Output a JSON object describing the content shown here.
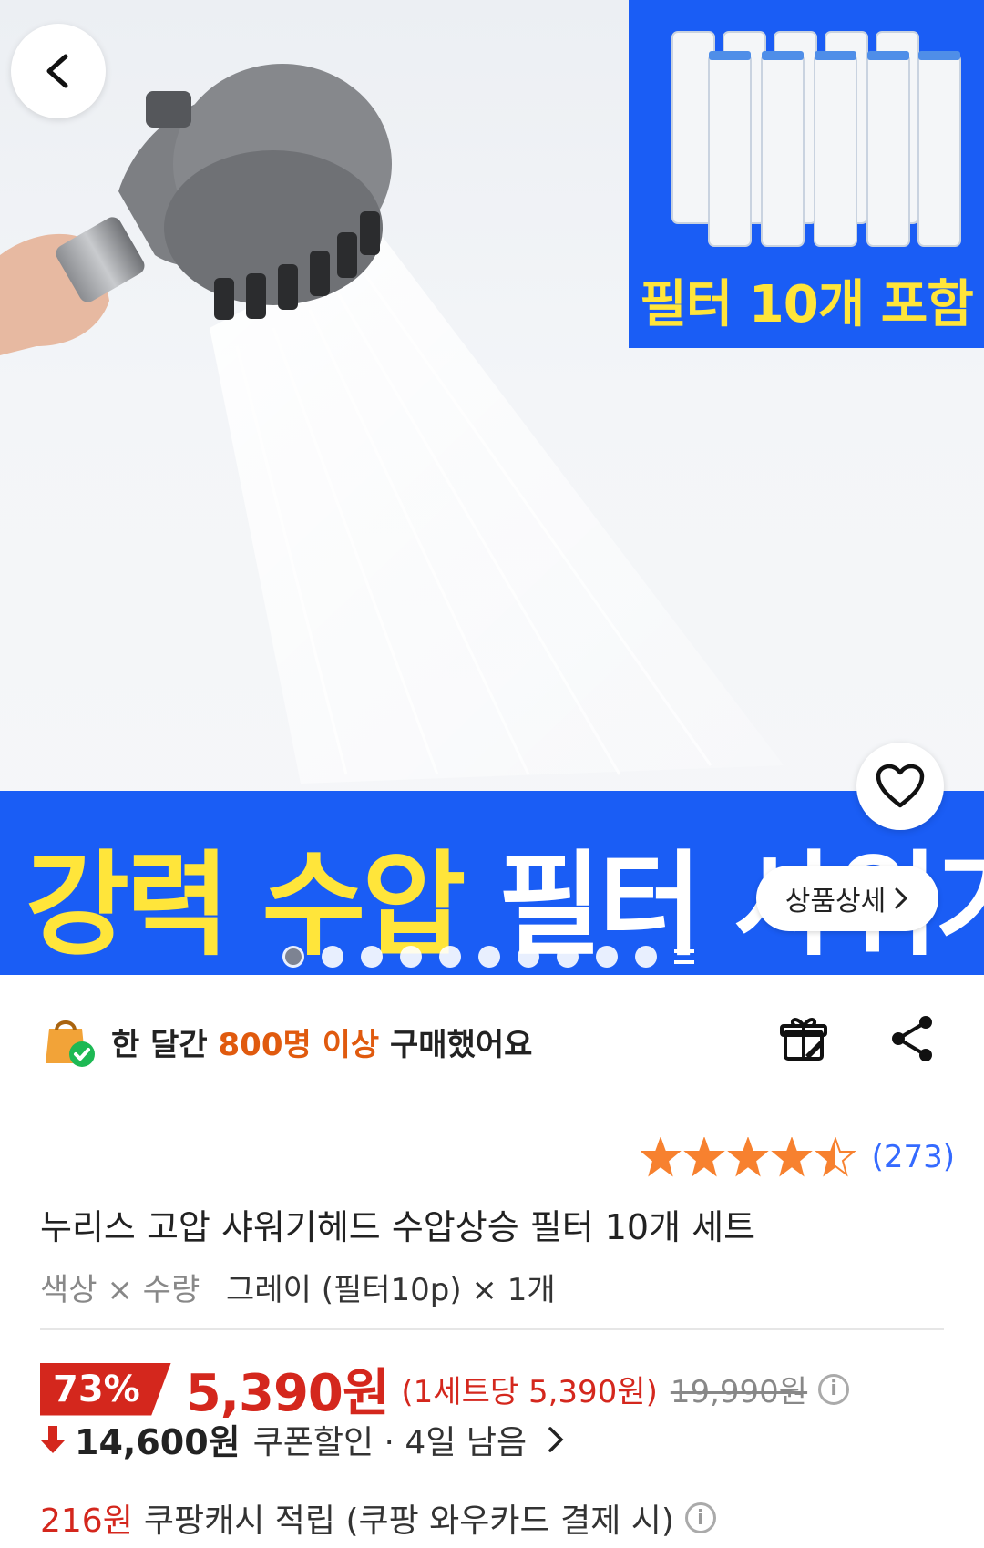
{
  "hero": {
    "filter_caption": "필터 10개 포함",
    "headline_yellow": "강력 수압",
    "headline_white": "필터 샤워기",
    "detail_button": "상품상세",
    "slide_count": 10,
    "active_slide": 1
  },
  "buy_info": {
    "prefix": "한 달간 ",
    "highlight": "800명 이상",
    "suffix": " 구매했어요"
  },
  "rating": {
    "stars": 4.5,
    "review_count": "(273)"
  },
  "product": {
    "title": "누리스 고압 샤워기헤드 수압상승 필터 10개 세트",
    "option_label": "색상 × 수량",
    "option_value": "그레이 (필터10p) × 1개"
  },
  "price": {
    "discount": "73%",
    "sale_price": "5,390원",
    "unit_price": "(1세트당 5,390원)",
    "original_price": "19,990원"
  },
  "coupon": {
    "amount": "14,600원",
    "text": "쿠폰할인 · 4일 남음"
  },
  "cash": {
    "amount": "216원",
    "text": "쿠팡캐시 적립 (쿠팡 와우카드 결제 시)"
  },
  "colors": {
    "brand_blue": "#1a5df5",
    "headline_yellow": "#ffe53a",
    "price_red": "#d4271d",
    "highlight_orange": "#e05a0e",
    "star_orange": "#f7812f",
    "review_blue": "#346aff"
  }
}
